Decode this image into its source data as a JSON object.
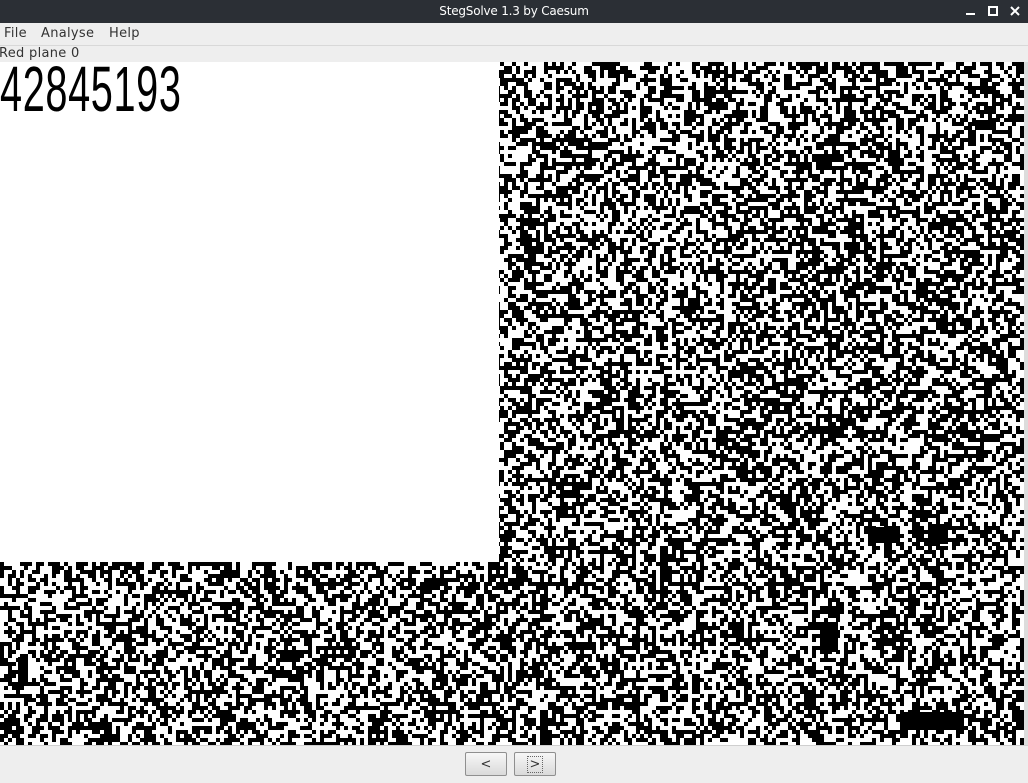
{
  "window": {
    "title": "StegSolve 1.3 by Caesum",
    "controls": {
      "minimize_icon": "minimize-icon",
      "maximize_icon": "maximize-icon",
      "close_icon": "close-icon"
    }
  },
  "menubar": {
    "items": [
      {
        "label": "File"
      },
      {
        "label": "Analyse"
      },
      {
        "label": "Help"
      }
    ]
  },
  "status": {
    "plane_label": "Red plane 0"
  },
  "image": {
    "hidden_text": "42845193",
    "colors": {
      "foreground": "#000000",
      "background": "#ffffff"
    }
  },
  "navigation": {
    "prev_label": "<",
    "next_label": ">"
  }
}
